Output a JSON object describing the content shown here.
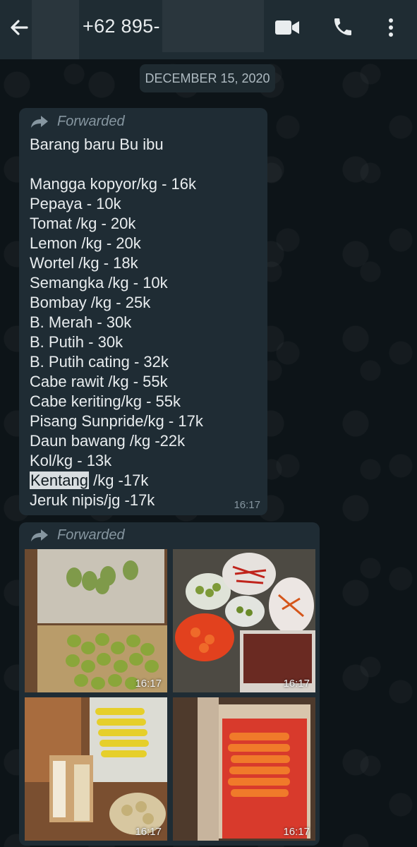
{
  "header": {
    "phone": "+62 895-",
    "icons": {
      "back": "back-arrow-icon",
      "video": "video-call-icon",
      "call": "phone-call-icon",
      "menu": "more-options-icon"
    }
  },
  "date_separator": "DECEMBER 15, 2020",
  "message1": {
    "forwarded_label": "Forwarded",
    "lines": [
      "Barang baru Bu ibu",
      "",
      "Mangga kopyor/kg - 16k",
      "Pepaya - 10k",
      "Tomat /kg - 20k",
      "Lemon /kg - 20k",
      "Wortel /kg - 18k",
      "Semangka /kg - 10k",
      "Bombay /kg - 25k",
      "B. Merah - 30k",
      "B. Putih - 30k",
      "B. Putih cating - 32k",
      "Cabe rawit /kg - 55k",
      "Cabe keriting/kg - 55k",
      "Pisang Sunpride/kg - 17k",
      "Daun bawang /kg -22k",
      "Kol/kg - 13k"
    ],
    "highlighted_word": "Kentang",
    "highlighted_line_rest": " /kg -17k",
    "last_line": "Jeruk nipis/jg -17k",
    "time": "16:17"
  },
  "message2": {
    "forwarded_label": "Forwarded",
    "photos": [
      {
        "description_icon": "mangoes-photo",
        "time": "16:17"
      },
      {
        "description_icon": "vegetables-photo",
        "time": "16:17"
      },
      {
        "description_icon": "bananas-photo",
        "time": "16:17"
      },
      {
        "description_icon": "carrots-photo",
        "time": "16:17"
      }
    ]
  },
  "colors": {
    "header_bg": "#1f2c33",
    "bubble_bg": "#1f2c34",
    "text": "#e9edef",
    "meta": "#8696a0"
  }
}
